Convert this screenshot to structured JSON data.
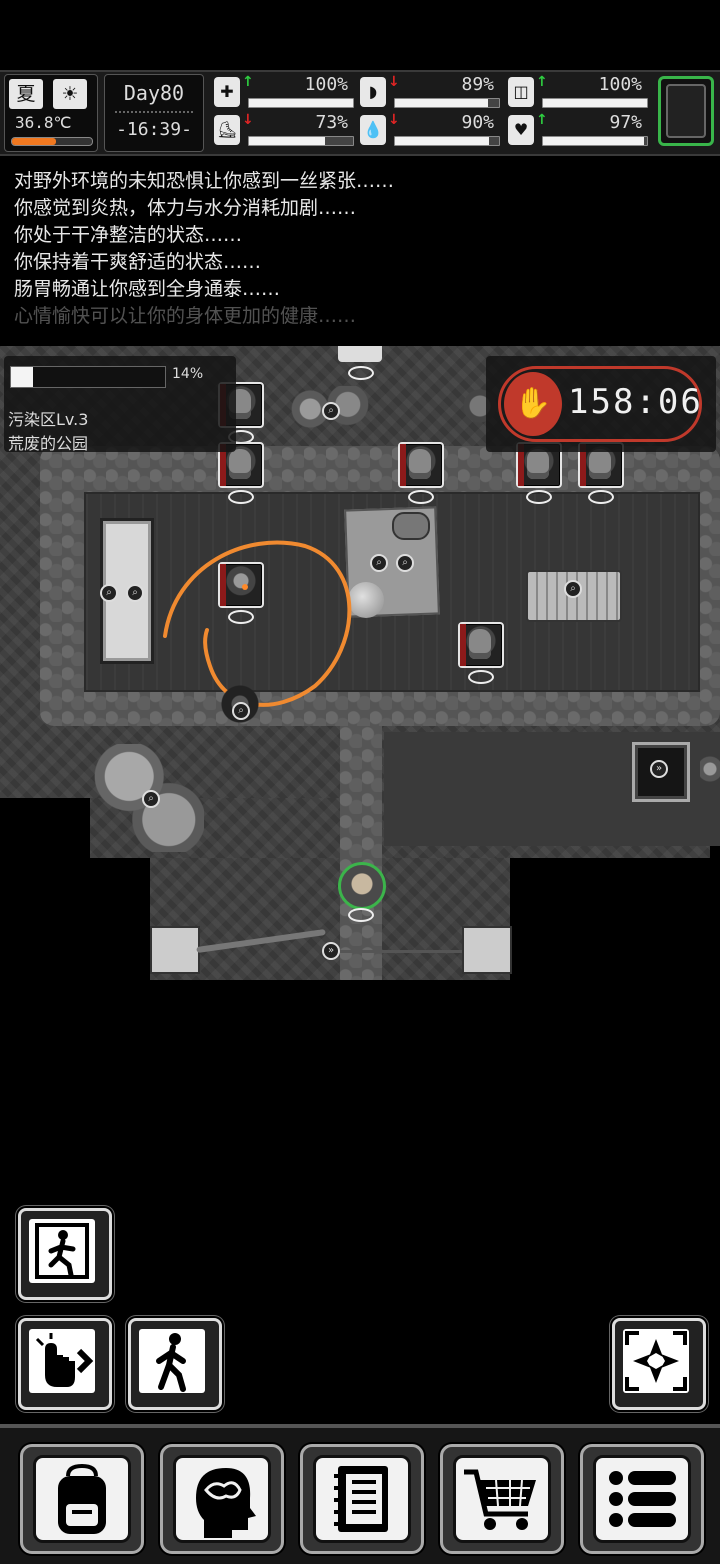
{
  "hud": {
    "season": "夏",
    "weather_icon": "sun-icon",
    "temperature": "36.8℃",
    "temperature_level": 0.55,
    "day": "Day80",
    "time": "-16:39-",
    "stats_left": [
      {
        "name": "health",
        "icon": "medkit-icon",
        "trend": "up",
        "value": "100%",
        "level": 1.0
      },
      {
        "name": "stamina",
        "icon": "boot-icon",
        "trend": "down",
        "value": "73%",
        "level": 0.73
      }
    ],
    "stats_mid": [
      {
        "name": "hunger",
        "icon": "stomach-icon",
        "trend": "down",
        "value": "89%",
        "level": 0.89
      },
      {
        "name": "thirst",
        "icon": "water-drop-icon",
        "trend": "down",
        "value": "90%",
        "level": 0.9
      }
    ],
    "stats_right": [
      {
        "name": "immunity",
        "icon": "pill-icon",
        "trend": "up",
        "value": "100%",
        "level": 1.0
      },
      {
        "name": "mood",
        "icon": "heart-icon",
        "trend": "up",
        "value": "97%",
        "level": 0.97
      }
    ]
  },
  "log": [
    "对野外环境的未知恐惧让你感到一丝紧张……",
    "你感觉到炎热，体力与水分消耗加剧……",
    "你处于干净整洁的状态……",
    "你保持着干爽舒适的状态……",
    "肠胃畅通让你感到全身通泰……",
    "心情愉快可以让你的身体更加的健康……"
  ],
  "zone": {
    "explore_percent": "14%",
    "explore_level": 0.14,
    "zone_level": "污染区Lv.3",
    "location": "荒废的公园"
  },
  "countdown": {
    "icon": "zombie-hand-icon",
    "time": "158:06",
    "accent": "#c0392b"
  },
  "controls": {
    "exit_icon": "exit-door-icon",
    "interact_icon": "tap-hand-icon",
    "walk_icon": "walk-icon",
    "center_icon": "center-map-icon"
  },
  "menu": [
    {
      "name": "backpack",
      "icon": "backpack-icon"
    },
    {
      "name": "skills",
      "icon": "brain-head-icon"
    },
    {
      "name": "journal",
      "icon": "notebook-icon"
    },
    {
      "name": "shop",
      "icon": "cart-icon"
    },
    {
      "name": "menu",
      "icon": "menu-list-icon"
    }
  ],
  "annotation_color": "#f08a30"
}
